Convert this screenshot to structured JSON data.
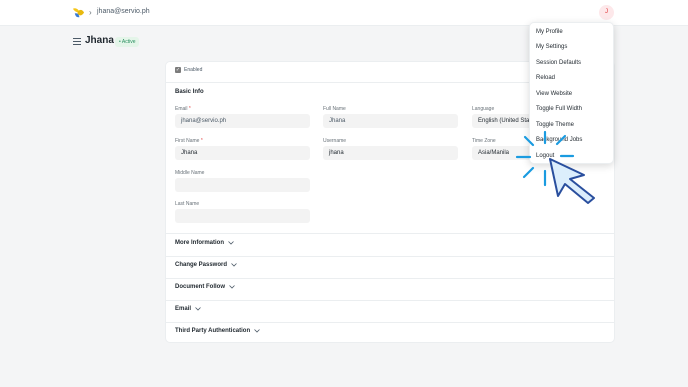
{
  "header": {
    "breadcrumb_sep": "›",
    "breadcrumb_user": "jhana@servio.ph",
    "avatar_initial": "J"
  },
  "page": {
    "title": "Jhana",
    "status_badge": "• Active"
  },
  "form": {
    "enabled_label": "Enabled",
    "basic_info_title": "Basic Info",
    "email_label": "Email",
    "email_value": "jhana@servio.ph",
    "full_name_label": "Full Name",
    "full_name_value": "Jhana",
    "language_label": "Language",
    "language_value": "English (United States)",
    "first_name_label": "First Name",
    "first_name_value": "Jhana",
    "username_label": "Username",
    "username_value": "jhana",
    "time_zone_label": "Time Zone",
    "time_zone_value": "Asia/Manila",
    "middle_name_label": "Middle Name",
    "last_name_label": "Last Name",
    "required_mark": "*"
  },
  "sections": {
    "more_information": "More Information",
    "change_password": "Change Password",
    "document_follow": "Document Follow",
    "email": "Email",
    "third_party_auth": "Third Party Authentication"
  },
  "menu": {
    "items": [
      "My Profile",
      "My Settings",
      "Session Defaults",
      "Reload",
      "View Website",
      "Toggle Full Width",
      "Toggle Theme",
      "Background Jobs",
      "Logout"
    ]
  },
  "colors": {
    "accent_blue": "#1a9be0",
    "active_green": "#278f5e",
    "avatar_red": "#e03636"
  }
}
